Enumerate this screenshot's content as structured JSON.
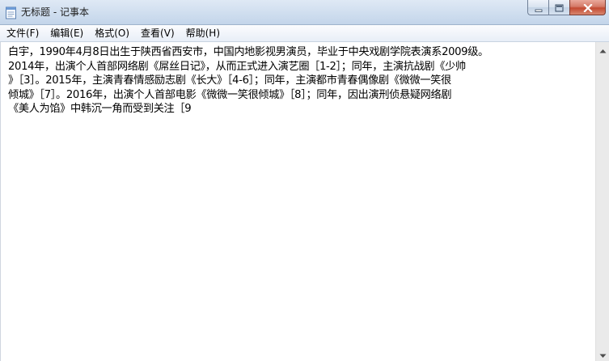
{
  "window": {
    "title": "无标题 - 记事本",
    "icon": "notepad-icon"
  },
  "caption_buttons": {
    "minimize_icon": "minimize-icon",
    "maximize_icon": "maximize-icon",
    "close_icon": "close-icon"
  },
  "menu": {
    "items": [
      {
        "label": "文件(F)"
      },
      {
        "label": "编辑(E)"
      },
      {
        "label": "格式(O)"
      },
      {
        "label": "查看(V)"
      },
      {
        "label": "帮助(H)"
      }
    ]
  },
  "document": {
    "lines": [
      "白宇，1990年4月8日出生于陕西省西安市，中国内地影视男演员，毕业于中央戏剧学院表演系2009级。",
      "2014年，出演个人首部网络剧《屌丝日记》，从而正式进入演艺圈［1-2］；同年，主演抗战剧《少帅",
      "》［3］。2015年，主演青春情感励志剧《长大》［4-6］；同年，主演都市青春偶像剧《微微一笑很",
      "倾城》［7］。2016年，出演个人首部电影《微微一笑很倾城》［8］；同年，因出演刑侦悬疑网络剧",
      "《美人为馅》中韩沉一角而受到关注［9"
    ]
  },
  "scrollbar": {
    "up_icon": "scroll-up-arrow-icon",
    "down_icon": "scroll-down-arrow-icon"
  },
  "colors": {
    "titlebar": "#d2e0f0",
    "close_button": "#c34a32",
    "text": "#000000"
  }
}
